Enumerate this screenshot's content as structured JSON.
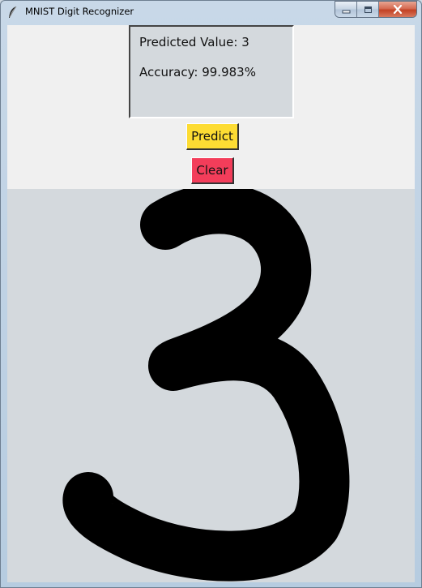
{
  "window": {
    "title": "MNIST Digit Recognizer",
    "icons": {
      "app": "feather-icon",
      "minimize": "minimize-icon",
      "maximize": "maximize-icon",
      "close": "close-icon"
    }
  },
  "result": {
    "predicted_label": "Predicted Value: 3",
    "accuracy_label": "Accuracy: 99.983%"
  },
  "buttons": {
    "predict_label": "Predict",
    "clear_label": "Clear",
    "predict_color": "#fddc33",
    "clear_color": "#f33d5a"
  },
  "canvas": {
    "background": "#d4d9dd",
    "stroke_color": "#000000",
    "drawn_digit": "3"
  }
}
